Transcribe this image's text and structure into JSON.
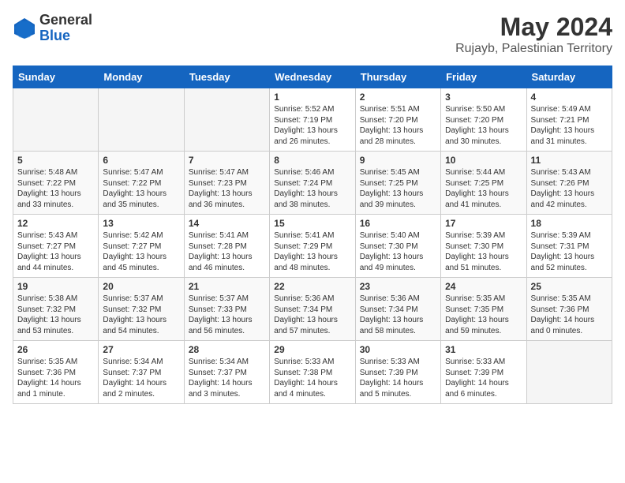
{
  "logo": {
    "general": "General",
    "blue": "Blue"
  },
  "title": "May 2024",
  "location": "Rujayb, Palestinian Territory",
  "days_of_week": [
    "Sunday",
    "Monday",
    "Tuesday",
    "Wednesday",
    "Thursday",
    "Friday",
    "Saturday"
  ],
  "weeks": [
    [
      {
        "day": "",
        "info": ""
      },
      {
        "day": "",
        "info": ""
      },
      {
        "day": "",
        "info": ""
      },
      {
        "day": "1",
        "info": "Sunrise: 5:52 AM\nSunset: 7:19 PM\nDaylight: 13 hours\nand 26 minutes."
      },
      {
        "day": "2",
        "info": "Sunrise: 5:51 AM\nSunset: 7:20 PM\nDaylight: 13 hours\nand 28 minutes."
      },
      {
        "day": "3",
        "info": "Sunrise: 5:50 AM\nSunset: 7:20 PM\nDaylight: 13 hours\nand 30 minutes."
      },
      {
        "day": "4",
        "info": "Sunrise: 5:49 AM\nSunset: 7:21 PM\nDaylight: 13 hours\nand 31 minutes."
      }
    ],
    [
      {
        "day": "5",
        "info": "Sunrise: 5:48 AM\nSunset: 7:22 PM\nDaylight: 13 hours\nand 33 minutes."
      },
      {
        "day": "6",
        "info": "Sunrise: 5:47 AM\nSunset: 7:22 PM\nDaylight: 13 hours\nand 35 minutes."
      },
      {
        "day": "7",
        "info": "Sunrise: 5:47 AM\nSunset: 7:23 PM\nDaylight: 13 hours\nand 36 minutes."
      },
      {
        "day": "8",
        "info": "Sunrise: 5:46 AM\nSunset: 7:24 PM\nDaylight: 13 hours\nand 38 minutes."
      },
      {
        "day": "9",
        "info": "Sunrise: 5:45 AM\nSunset: 7:25 PM\nDaylight: 13 hours\nand 39 minutes."
      },
      {
        "day": "10",
        "info": "Sunrise: 5:44 AM\nSunset: 7:25 PM\nDaylight: 13 hours\nand 41 minutes."
      },
      {
        "day": "11",
        "info": "Sunrise: 5:43 AM\nSunset: 7:26 PM\nDaylight: 13 hours\nand 42 minutes."
      }
    ],
    [
      {
        "day": "12",
        "info": "Sunrise: 5:43 AM\nSunset: 7:27 PM\nDaylight: 13 hours\nand 44 minutes."
      },
      {
        "day": "13",
        "info": "Sunrise: 5:42 AM\nSunset: 7:27 PM\nDaylight: 13 hours\nand 45 minutes."
      },
      {
        "day": "14",
        "info": "Sunrise: 5:41 AM\nSunset: 7:28 PM\nDaylight: 13 hours\nand 46 minutes."
      },
      {
        "day": "15",
        "info": "Sunrise: 5:41 AM\nSunset: 7:29 PM\nDaylight: 13 hours\nand 48 minutes."
      },
      {
        "day": "16",
        "info": "Sunrise: 5:40 AM\nSunset: 7:30 PM\nDaylight: 13 hours\nand 49 minutes."
      },
      {
        "day": "17",
        "info": "Sunrise: 5:39 AM\nSunset: 7:30 PM\nDaylight: 13 hours\nand 51 minutes."
      },
      {
        "day": "18",
        "info": "Sunrise: 5:39 AM\nSunset: 7:31 PM\nDaylight: 13 hours\nand 52 minutes."
      }
    ],
    [
      {
        "day": "19",
        "info": "Sunrise: 5:38 AM\nSunset: 7:32 PM\nDaylight: 13 hours\nand 53 minutes."
      },
      {
        "day": "20",
        "info": "Sunrise: 5:37 AM\nSunset: 7:32 PM\nDaylight: 13 hours\nand 54 minutes."
      },
      {
        "day": "21",
        "info": "Sunrise: 5:37 AM\nSunset: 7:33 PM\nDaylight: 13 hours\nand 56 minutes."
      },
      {
        "day": "22",
        "info": "Sunrise: 5:36 AM\nSunset: 7:34 PM\nDaylight: 13 hours\nand 57 minutes."
      },
      {
        "day": "23",
        "info": "Sunrise: 5:36 AM\nSunset: 7:34 PM\nDaylight: 13 hours\nand 58 minutes."
      },
      {
        "day": "24",
        "info": "Sunrise: 5:35 AM\nSunset: 7:35 PM\nDaylight: 13 hours\nand 59 minutes."
      },
      {
        "day": "25",
        "info": "Sunrise: 5:35 AM\nSunset: 7:36 PM\nDaylight: 14 hours\nand 0 minutes."
      }
    ],
    [
      {
        "day": "26",
        "info": "Sunrise: 5:35 AM\nSunset: 7:36 PM\nDaylight: 14 hours\nand 1 minute."
      },
      {
        "day": "27",
        "info": "Sunrise: 5:34 AM\nSunset: 7:37 PM\nDaylight: 14 hours\nand 2 minutes."
      },
      {
        "day": "28",
        "info": "Sunrise: 5:34 AM\nSunset: 7:37 PM\nDaylight: 14 hours\nand 3 minutes."
      },
      {
        "day": "29",
        "info": "Sunrise: 5:33 AM\nSunset: 7:38 PM\nDaylight: 14 hours\nand 4 minutes."
      },
      {
        "day": "30",
        "info": "Sunrise: 5:33 AM\nSunset: 7:39 PM\nDaylight: 14 hours\nand 5 minutes."
      },
      {
        "day": "31",
        "info": "Sunrise: 5:33 AM\nSunset: 7:39 PM\nDaylight: 14 hours\nand 6 minutes."
      },
      {
        "day": "",
        "info": ""
      }
    ]
  ]
}
